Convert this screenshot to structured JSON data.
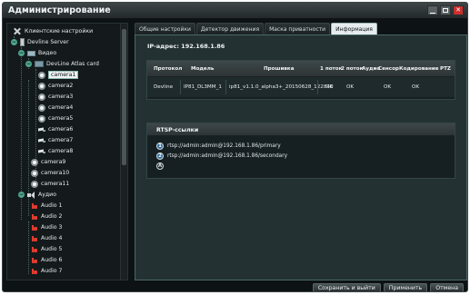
{
  "window": {
    "title": "Администрирование"
  },
  "tree": {
    "items": [
      {
        "label": "Клиентские настройки"
      },
      {
        "label": "Devline Server"
      },
      {
        "label": "Видео"
      },
      {
        "label": "DevLine Atlas card"
      },
      {
        "label": "camera1"
      },
      {
        "label": "camera2"
      },
      {
        "label": "camera3"
      },
      {
        "label": "camera4"
      },
      {
        "label": "camera5"
      },
      {
        "label": "camera6"
      },
      {
        "label": "camera7"
      },
      {
        "label": "camera8"
      },
      {
        "label": "camera9"
      },
      {
        "label": "camera10"
      },
      {
        "label": "camera11"
      },
      {
        "label": "Аудио"
      },
      {
        "label": "Audio 1"
      },
      {
        "label": "Audio 2"
      },
      {
        "label": "Audio 3"
      },
      {
        "label": "Audio 4"
      },
      {
        "label": "Audio 5"
      },
      {
        "label": "Audio 6"
      },
      {
        "label": "Audio 7"
      }
    ],
    "toggles": {
      "minus": "−"
    }
  },
  "tabs": [
    {
      "label": "Общие настройки"
    },
    {
      "label": "Детектор движения"
    },
    {
      "label": "Маска приватности"
    },
    {
      "label": "Информация"
    }
  ],
  "info": {
    "ip_line": "IP-адрес: 192.168.1.86",
    "table": {
      "headers": [
        "Протокол",
        "Модель",
        "Прошивка",
        "1 поток",
        "2 поток",
        "Аудио",
        "Сенсор",
        "Кодирование",
        "PTZ"
      ],
      "row": [
        "Devline",
        "IP81_DL3MM_1",
        "ip81_v1.1.0_alpha3+_20150628_122840",
        "OK",
        "OK",
        "",
        "OK",
        "OK",
        ""
      ]
    }
  },
  "rtsp": {
    "title": "RTSP-ссылки",
    "links": [
      {
        "num": "1",
        "url": "rtsp://admin:admin@192.168.1.86/primary"
      },
      {
        "num": "2",
        "url": "rtsp://admin:admin@192.168.1.86/secondary"
      }
    ],
    "add_glyph": "A"
  },
  "footer": {
    "save_exit": "Сохранить и выйти",
    "apply": "Применить",
    "cancel": "Отмена"
  }
}
